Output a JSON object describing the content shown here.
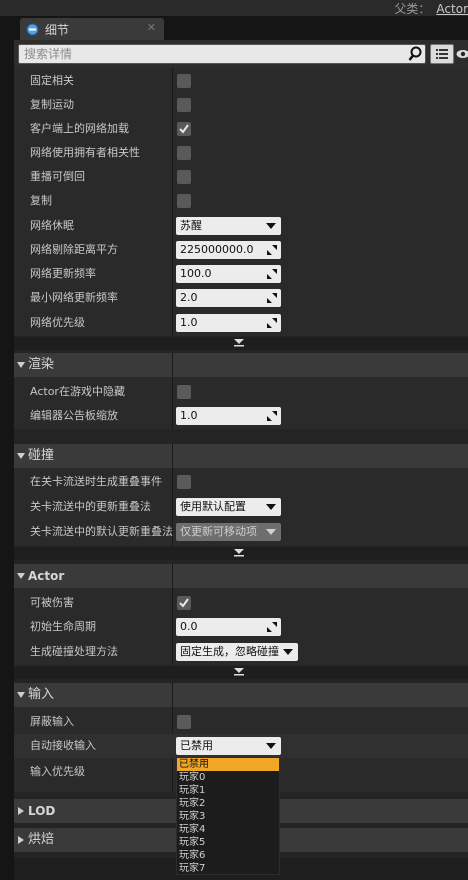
{
  "top_bar": {
    "parent_label": "父类：",
    "parent_value": "Actor"
  },
  "tab": {
    "label": "细节"
  },
  "search": {
    "placeholder": "搜索详情"
  },
  "replication": {
    "rows": [
      {
        "label": "固定相关",
        "checkbox": false
      },
      {
        "label": "复制运动",
        "checkbox": false
      },
      {
        "label": "客户端上的网络加载",
        "checkbox": true
      },
      {
        "label": "网络使用拥有者相关性",
        "checkbox": false
      },
      {
        "label": "重播可倒回",
        "checkbox": false
      },
      {
        "label": "复制",
        "checkbox": false
      },
      {
        "label": "网络休眠",
        "combo": "苏醒"
      },
      {
        "label": "网络剔除距离平方",
        "value": "225000000.0"
      },
      {
        "label": "网络更新频率",
        "value": "100.0"
      },
      {
        "label": "最小网络更新频率",
        "value": "2.0"
      },
      {
        "label": "网络优先级",
        "value": "1.0"
      }
    ]
  },
  "rendering": {
    "title": "渲染",
    "rows": [
      {
        "label": "Actor在游戏中隐藏",
        "checkbox": false
      },
      {
        "label": "编辑器公告板缩放",
        "value": "1.0"
      }
    ]
  },
  "collision": {
    "title": "碰撞",
    "rows": [
      {
        "label": "在关卡流送时生成重叠事件",
        "checkbox": false
      },
      {
        "label": "关卡流送中的更新重叠法",
        "combo": "使用默认配置"
      },
      {
        "label": "关卡流送中的默认更新重叠法",
        "combo": "仅更新可移动项",
        "disabled": true
      }
    ]
  },
  "actor": {
    "title": "Actor",
    "rows": [
      {
        "label": "可被伤害",
        "checkbox": true
      },
      {
        "label": "初始生命周期",
        "value": "0.0"
      },
      {
        "label": "生成碰撞处理方法",
        "combo": "固定生成，忽略碰撞"
      }
    ]
  },
  "input": {
    "title": "输入",
    "rows": [
      {
        "label": "屏蔽输入",
        "checkbox": false
      },
      {
        "label": "自动接收输入",
        "combo": "已禁用"
      },
      {
        "label": "输入优先级"
      }
    ]
  },
  "lod": {
    "title": "LOD"
  },
  "baking": {
    "title": "烘焙"
  },
  "dropdown": {
    "selected_index": 0,
    "options": [
      "已禁用",
      "玩家0",
      "玩家1",
      "玩家2",
      "玩家3",
      "玩家4",
      "玩家5",
      "玩家6",
      "玩家7"
    ]
  },
  "colors": {
    "panel": "#242424",
    "section_header": "#3a3a3a",
    "dropdown_highlight": "#f2a625",
    "input_field": "#ececec"
  }
}
